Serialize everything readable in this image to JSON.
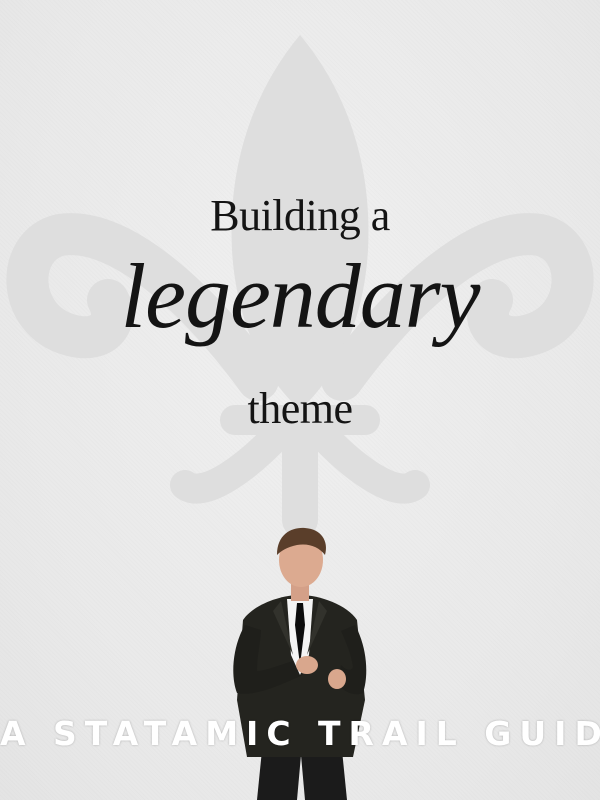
{
  "cover": {
    "title_line_1": "Building a",
    "title_line_2": "legendary",
    "title_line_3": "theme",
    "subtitle": "A STATAMIC TRAIL GUIDE",
    "background_color": "#ededed",
    "watermark_color": "#dcdcdc",
    "title_color": "#141414",
    "subtitle_color": "#ffffff"
  },
  "images": {
    "watermark": "fleur-de-lis-watermark",
    "figure": "man-in-black-suit-photo"
  }
}
